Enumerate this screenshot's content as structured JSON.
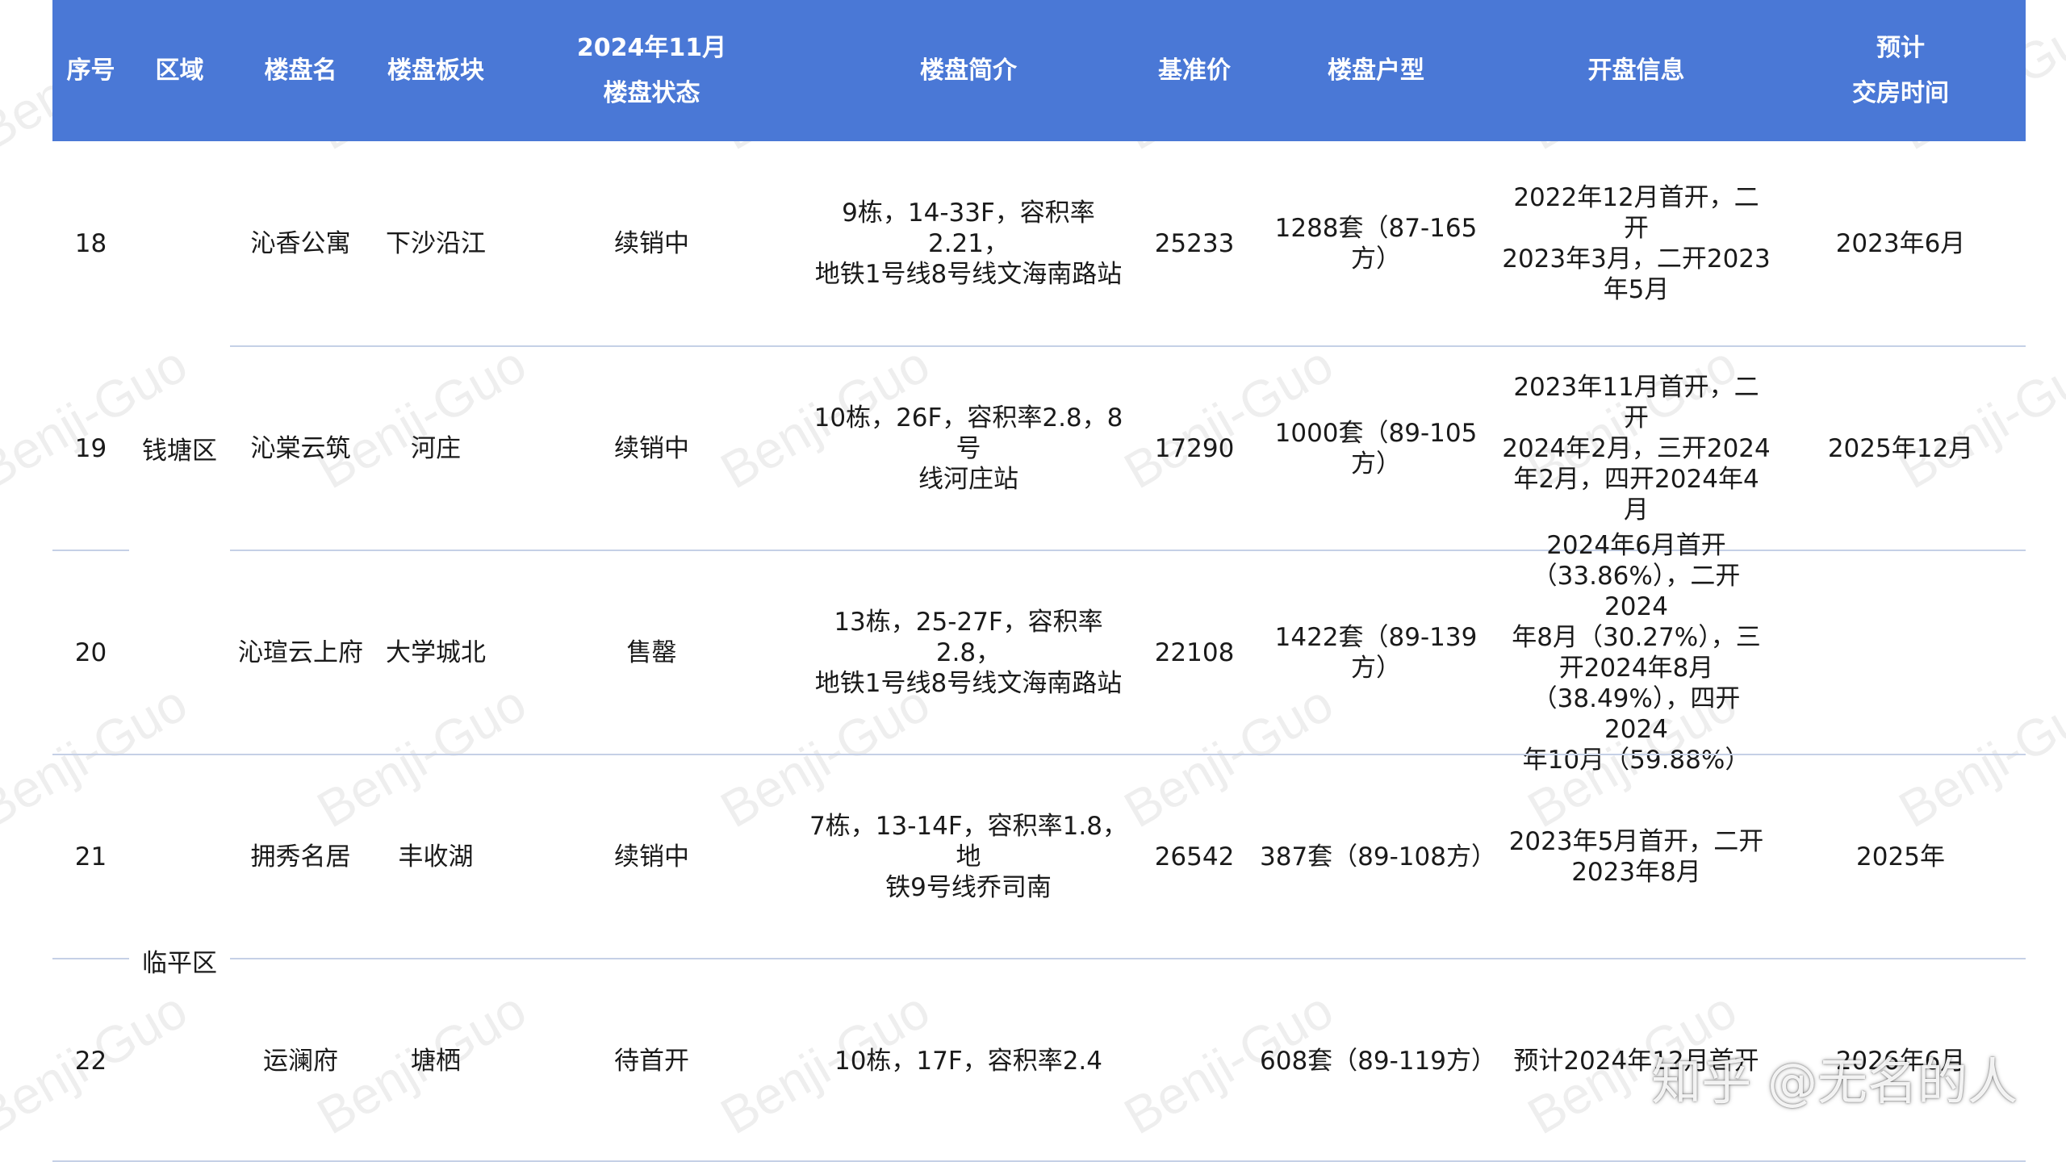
{
  "headers": [
    "序号",
    "区域",
    "楼盘名",
    "楼盘板块",
    "2024年11月\n楼盘状态",
    "楼盘简介",
    "基准价",
    "楼盘户型",
    "开盘信息",
    "预计\n交房时间"
  ],
  "districts": {
    "qiantang": "钱塘区",
    "linping": "临平区"
  },
  "rows": [
    {
      "no": "18",
      "name": "沁香公寓",
      "block": "下沙沿江",
      "status": "续销中",
      "intro": [
        "9栋，14-33F，容积率2.21，",
        "地铁1号线8号线文海南路站"
      ],
      "price": "25233",
      "units": "1288套（87-165方）",
      "opening": [
        "2022年12月首开，二开",
        "2023年3月，二开2023",
        "年5月"
      ],
      "delivery": "2023年6月"
    },
    {
      "no": "19",
      "name": "沁棠云筑",
      "block": "河庄",
      "status": "续销中",
      "intro": [
        "10栋，26F，容积率2.8，8号",
        "线河庄站"
      ],
      "price": "17290",
      "units": "1000套（89-105方）",
      "opening": [
        "2023年11月首开，二开",
        "2024年2月，三开2024",
        "年2月，四开2024年4月"
      ],
      "delivery": "2025年12月"
    },
    {
      "no": "20",
      "name": "沁瑄云上府",
      "block": "大学城北",
      "status": "售罄",
      "intro": [
        "13栋，25-27F，容积率2.8，",
        "地铁1号线8号线文海南路站"
      ],
      "price": "22108",
      "units": "1422套（89-139方）",
      "opening": [
        "2024年6月首开",
        "（33.86%），二开2024",
        "年8月（30.27%），三",
        "开2024年8月",
        "（38.49%），四开2024",
        "年10月（59.88%）"
      ],
      "delivery": ""
    },
    {
      "no": "21",
      "name": "拥秀名居",
      "block": "丰收湖",
      "status": "续销中",
      "intro": [
        "7栋，13-14F，容积率1.8，地",
        "铁9号线乔司南"
      ],
      "price": "26542",
      "units": "387套（89-108方）",
      "opening": [
        "2023年5月首开，二开",
        "2023年8月"
      ],
      "delivery": "2025年"
    },
    {
      "no": "22",
      "name": "运澜府",
      "block": "塘栖",
      "status": "待首开",
      "intro": [
        "10栋，17F，容积率2.4"
      ],
      "price": "",
      "units": "608套（89-119方）",
      "opening": [
        "预计2024年12月首开"
      ],
      "delivery": "2026年6月"
    }
  ],
  "watermark_text": "Benji-Guo",
  "zhihu_mark": "知乎 @无名的人",
  "colors": {
    "header_bg": "#4a78d6",
    "header_text": "#ffffff",
    "row_line": "#c5d0e6"
  }
}
